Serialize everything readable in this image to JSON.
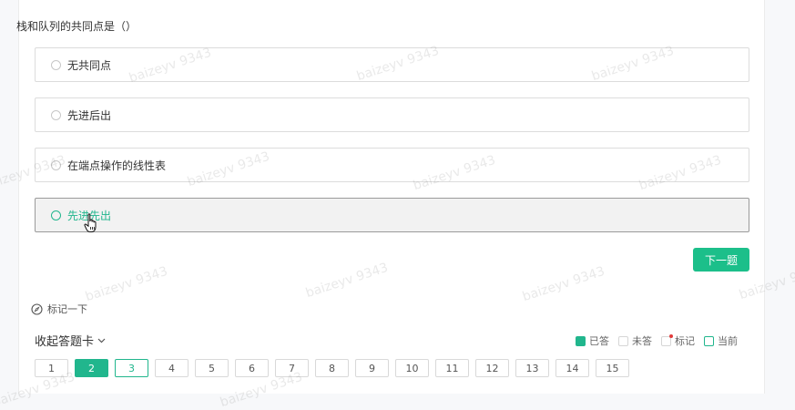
{
  "question": {
    "text": "栈和队列的共同点是（）"
  },
  "options": [
    {
      "label": "无共同点"
    },
    {
      "label": "先进后出"
    },
    {
      "label": "在端点操作的线性表"
    },
    {
      "label": "先进先出"
    }
  ],
  "next_button": {
    "label": "下一题"
  },
  "mark_label": "标记一下",
  "card_panel": {
    "collapse_label": "收起答题卡",
    "legend": {
      "answered": "已答",
      "unanswered": "未答",
      "marked": "标记",
      "current": "当前"
    },
    "questions": [
      "1",
      "2",
      "3",
      "4",
      "5",
      "6",
      "7",
      "8",
      "9",
      "10",
      "11",
      "12",
      "13",
      "14",
      "15"
    ],
    "answered_index": 1,
    "current_index": 2
  },
  "watermark": "baizeyv 9343",
  "colors": {
    "accent": "#21b68d",
    "button": "#1cbf8a",
    "marked_dot": "#e23b3b"
  }
}
